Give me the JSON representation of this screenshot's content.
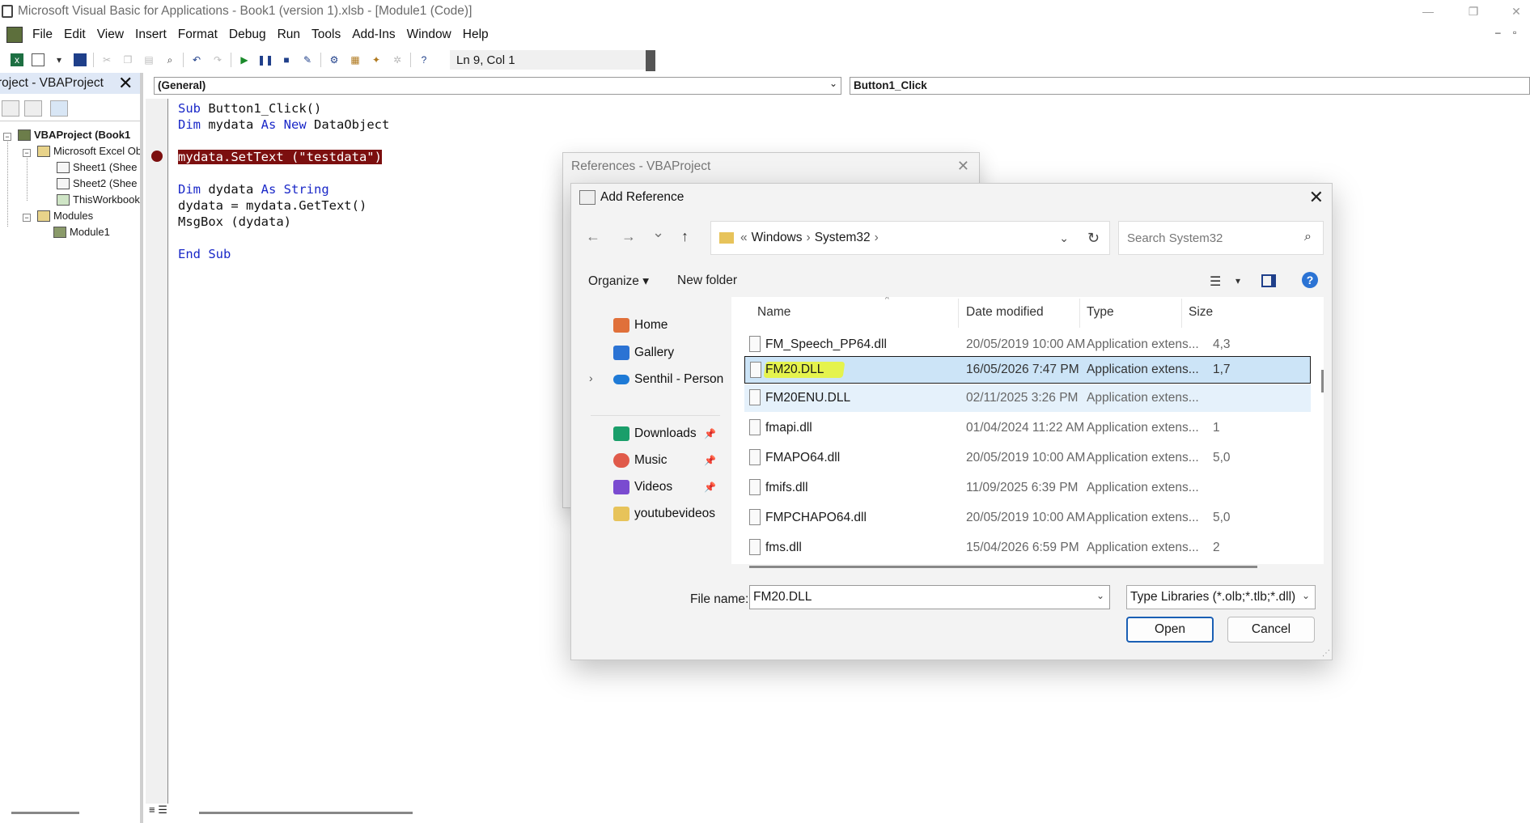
{
  "window": {
    "title": "Microsoft Visual Basic for Applications - Book1 (version 1).xlsb - [Module1 (Code)]",
    "controls": {
      "minimize": "—",
      "restore": "❐",
      "close": "✕"
    }
  },
  "menu": {
    "items": [
      "File",
      "Edit",
      "View",
      "Insert",
      "Format",
      "Debug",
      "Run",
      "Tools",
      "Add-Ins",
      "Window",
      "Help"
    ],
    "mdi_minimize": "–",
    "mdi_restore": "▫"
  },
  "toolbar": {
    "position": "Ln 9, Col 1"
  },
  "project": {
    "title": "roject - VBAProject",
    "tree": [
      "VBAProject (Book1",
      "Microsoft Excel Ob",
      "Sheet1 (Shee",
      "Sheet2 (Shee",
      "ThisWorkbook",
      "Modules",
      "Module1"
    ]
  },
  "code_window": {
    "object_combo": "(General)",
    "proc_combo": "Button1_Click",
    "lines": {
      "l1_kw": "Sub",
      "l1_rest": " Button1_Click()",
      "l2_kw1": "Dim",
      "l2_mid": " mydata ",
      "l2_kw2": "As",
      "l2_sp": " ",
      "l2_kw3": "New",
      "l2_rest": " DataObject",
      "l4_hl": "mydata.SetText (\"testdata\")",
      "l6_kw1": "Dim",
      "l6_mid": " dydata ",
      "l6_kw2": "As",
      "l6_sp": " ",
      "l6_kw3": "String",
      "l7": "dydata = mydata.GetText()",
      "l8": "MsgBox (dydata)",
      "l10_kw": "End Sub"
    }
  },
  "references_dialog": {
    "title": "References - VBAProject",
    "close": "✕"
  },
  "add_reference_dialog": {
    "title": "Add Reference",
    "close": "✕",
    "nav": {
      "back": "←",
      "forward": "→",
      "recent": "⌄",
      "up": "↑"
    },
    "address": {
      "prefix": "«",
      "segments": [
        "Windows",
        "System32"
      ],
      "sep": "›",
      "dropdown": "⌄",
      "refresh": "↻"
    },
    "search_placeholder": "Search System32",
    "commands": {
      "organize": "Organize ▾",
      "new_folder": "New folder",
      "view_menu": "▾"
    },
    "nav_items": [
      {
        "label": "Home",
        "icon": "home-icon",
        "color": "#e0703a"
      },
      {
        "label": "Gallery",
        "icon": "gallery-icon",
        "color": "#2b73d4"
      },
      {
        "label": "Senthil - Persona",
        "icon": "onedrive-icon",
        "color": "#1e7ad6"
      },
      {
        "label": "Downloads",
        "icon": "downloads-icon",
        "color": "#1a9e6a"
      },
      {
        "label": "Music",
        "icon": "music-icon",
        "color": "#e05a4a"
      },
      {
        "label": "Videos",
        "icon": "videos-icon",
        "color": "#7a4bd0"
      },
      {
        "label": "youtubevideos",
        "icon": "folder-icon",
        "color": "#e7c35a"
      }
    ],
    "pin_glyph": "📌",
    "expand_glyph": "›",
    "columns": {
      "name": "Name",
      "date": "Date modified",
      "type": "Type",
      "size": "Size"
    },
    "files": [
      {
        "name": "FM_Speech_PP64.dll",
        "date": "20/05/2019 10:00 AM",
        "type": "Application extens...",
        "size": "4,3"
      },
      {
        "name": "FM20.DLL",
        "date": "16/05/2026 7:47 PM",
        "type": "Application extens...",
        "size": "1,7"
      },
      {
        "name": "FM20ENU.DLL",
        "date": "02/11/2025 3:26 PM",
        "type": "Application extens...",
        "size": ""
      },
      {
        "name": "fmapi.dll",
        "date": "01/04/2024 11:22 AM",
        "type": "Application extens...",
        "size": "1"
      },
      {
        "name": "FMAPO64.dll",
        "date": "20/05/2019 10:00 AM",
        "type": "Application extens...",
        "size": "5,0"
      },
      {
        "name": "fmifs.dll",
        "date": "11/09/2025 6:39 PM",
        "type": "Application extens...",
        "size": ""
      },
      {
        "name": "FMPCHAPO64.dll",
        "date": "20/05/2019 10:00 AM",
        "type": "Application extens...",
        "size": "5,0"
      },
      {
        "name": "fms.dll",
        "date": "15/04/2026 6:59 PM",
        "type": "Application extens...",
        "size": "2"
      }
    ],
    "file_name_label": "File name:",
    "file_name_value": "FM20.DLL",
    "file_type": "Type Libraries (*.olb;*.tlb;*.dll)",
    "open_label": "Open",
    "cancel_label": "Cancel"
  }
}
